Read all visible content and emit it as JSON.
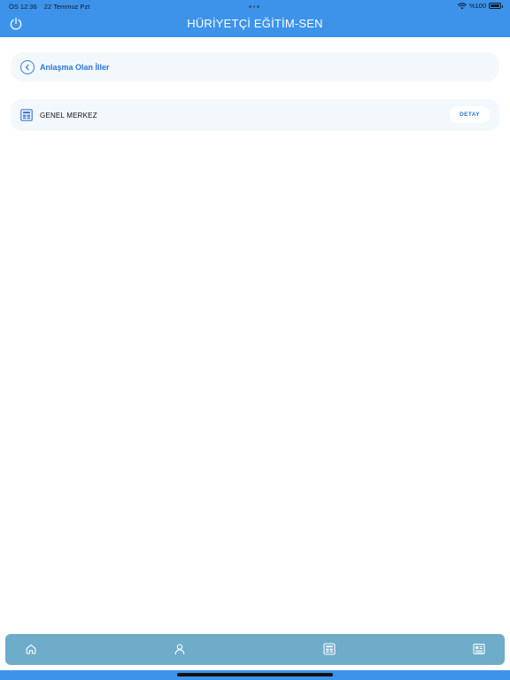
{
  "status_bar": {
    "time": "ÖS 12:36",
    "date": "22 Temmuz Pzt",
    "battery": "%100"
  },
  "header": {
    "title": "HÜRİYETÇİ EĞİTİM-SEN"
  },
  "breadcrumb": {
    "label": "Anlaşma Olan İller"
  },
  "items": [
    {
      "label": "GENEL MERKEZ",
      "action_label": "DETAY"
    }
  ],
  "tabbar": {
    "tabs": [
      {
        "icon": "home-icon"
      },
      {
        "icon": "person-icon"
      },
      {
        "icon": "grid-calendar-icon"
      },
      {
        "icon": "newspaper-icon"
      }
    ]
  },
  "colors": {
    "primary": "#3d93ea",
    "accent_text": "#2a77d4",
    "card_bg": "#f3f8fd",
    "tabbar_bg": "#6eacc9"
  }
}
